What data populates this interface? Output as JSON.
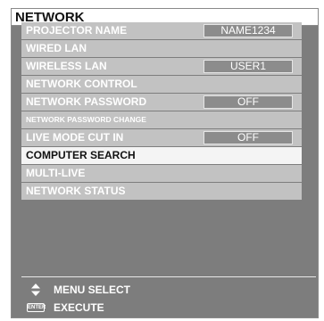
{
  "title": "NETWORK",
  "menu": [
    {
      "label": "PROJECTOR NAME",
      "value": "NAME1234"
    },
    {
      "label": "WIRED LAN"
    },
    {
      "label": "WIRELESS LAN",
      "value": "USER1"
    },
    {
      "label": "NETWORK CONTROL"
    },
    {
      "label": "NETWORK PASSWORD",
      "value": "OFF"
    },
    {
      "label": "NETWORK PASSWORD CHANGE"
    },
    {
      "label": "LIVE MODE CUT IN",
      "value": "OFF"
    },
    {
      "label": "COMPUTER SEARCH",
      "selected": true
    },
    {
      "label": "MULTI-LIVE"
    },
    {
      "label": "NETWORK STATUS"
    }
  ],
  "legend": {
    "menu_select": "MENU SELECT",
    "enter_badge": "ENTER",
    "execute": "EXECUTE"
  },
  "colors": {
    "panel": "#7d7d7d",
    "row": "#c2c2c2",
    "selected_row": "#f4f4f4"
  },
  "icons": [
    "up-down-arrows-icon",
    "enter-key-icon"
  ]
}
